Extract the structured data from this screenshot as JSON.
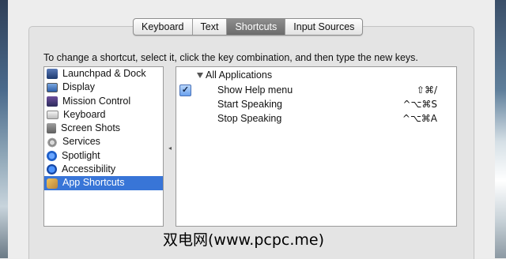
{
  "tabs": [
    {
      "label": "Keyboard",
      "active": false
    },
    {
      "label": "Text",
      "active": false
    },
    {
      "label": "Shortcuts",
      "active": true
    },
    {
      "label": "Input Sources",
      "active": false
    }
  ],
  "instruction": "To change a shortcut, select it, click the key combination, and then type the new keys.",
  "categories": [
    {
      "label": "Launchpad & Dock",
      "icon": "launchpad-icon"
    },
    {
      "label": "Display",
      "icon": "display-icon"
    },
    {
      "label": "Mission Control",
      "icon": "mission-control-icon"
    },
    {
      "label": "Keyboard",
      "icon": "keyboard-icon"
    },
    {
      "label": "Screen Shots",
      "icon": "screenshots-icon"
    },
    {
      "label": "Services",
      "icon": "services-icon"
    },
    {
      "label": "Spotlight",
      "icon": "spotlight-icon"
    },
    {
      "label": "Accessibility",
      "icon": "accessibility-icon"
    },
    {
      "label": "App Shortcuts",
      "icon": "app-shortcuts-icon",
      "selected": true
    }
  ],
  "shortcuts": {
    "group_label": "All Applications",
    "rows": [
      {
        "name": "Show Help menu",
        "keys": "⇧⌘/",
        "checked": true
      },
      {
        "name": "Start Speaking",
        "keys": "^⌥⌘S",
        "checked": false
      },
      {
        "name": "Stop Speaking",
        "keys": "^⌥⌘A",
        "checked": false
      }
    ]
  },
  "watermark": "双电网(www.pcpc.me)",
  "colors": {
    "selection": "#3875d7",
    "active_tab": "#7a7a7a"
  }
}
